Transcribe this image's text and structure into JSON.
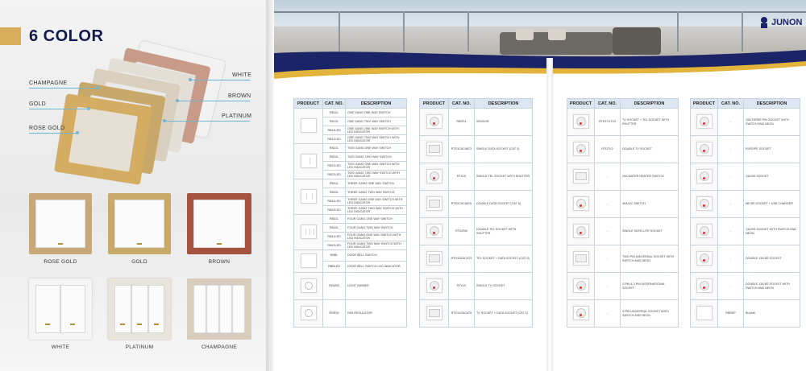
{
  "page1": {
    "title": "6 COLOR",
    "callouts_left": [
      "CHAMPAGNE",
      "GOLD",
      "ROSE GOLD"
    ],
    "callouts_right": [
      "WHITE",
      "BROWN",
      "PLATINUM"
    ],
    "swatch_labels": [
      "ROSE GOLD",
      "GOLD",
      "BROWN",
      "WHITE",
      "PLATINUM",
      "CHAMPAGNE"
    ],
    "colors": {
      "rose_gold": "#c9a877",
      "gold": "#c7a96a",
      "brown": "#a5523e",
      "white": "#f4f4f4",
      "platinum": "#e6e2da",
      "champagne": "#d8cdbc",
      "accent": "#d8ad5c",
      "navy": "#111a4a"
    }
  },
  "brand": {
    "logo_text": "JUNON"
  },
  "headers": [
    "PRODUCT",
    "CAT. NO.",
    "DESCRIPTION"
  ],
  "table1": [
    {
      "code": "RB11L",
      "desc": "ONE GANG ONE WAY SWITCH"
    },
    {
      "code": "RB12L",
      "desc": "ONE GANG TWO WAY SWITCH"
    },
    {
      "code": "RB11LED",
      "desc": "ONE GANG ONE WAY SWITCH WITH LED INDICATOR"
    },
    {
      "code": "RB12LED",
      "desc": "ONE GANG TWO WAY SWITCH WITH LED INDICATOR"
    },
    {
      "code": "RB21L",
      "desc": "TWO GANG ONE WAY SWITCH"
    },
    {
      "code": "RB22L",
      "desc": "TWO GANG TWO WAY SWITCH"
    },
    {
      "code": "RB21LED",
      "desc": "TWO GANG ONE WAY SWITCH WITH LED INDICATOR"
    },
    {
      "code": "RB22LED",
      "desc": "TWO GANG TWO WAY SWITCH WITH LED INDICATOR"
    },
    {
      "code": "RB31L",
      "desc": "THREE GANG ONE WAY SWITCH"
    },
    {
      "code": "RB32L",
      "desc": "THREE GANG TWO WAY SWITCH"
    },
    {
      "code": "RB31LED",
      "desc": "THREE GANG ONE WAY SWITCH WITH LED INDICATOR"
    },
    {
      "code": "RB32LED",
      "desc": "THREE GANG TWO WAY SWITCH WITH LED INDICATOR"
    },
    {
      "code": "RB41L",
      "desc": "FOUR GANG ONE WAY SWITCH"
    },
    {
      "code": "RB42L",
      "desc": "FOUR GANG TWO WAY SWITCH"
    },
    {
      "code": "RB41LED",
      "desc": "FOUR GANG ONE WAY SWITCH WITH LED INDICATOR"
    },
    {
      "code": "RB42LED",
      "desc": "FOUR GANG TWO WAY SWITCH WITH LED INDICATOR"
    },
    {
      "code": "RBBL",
      "desc": "DOOR BELL SWITCH"
    },
    {
      "code": "RBBLED",
      "desc": "DOOR BELL SWITCH LED INDICATOR"
    },
    {
      "code": "RDM30",
      "desc": "LIGHT DIMMER"
    },
    {
      "code": "RSR30",
      "desc": "FAN REGULATOR"
    }
  ],
  "table2": [
    {
      "code": "RBRS1",
      "desc": "SENSOR"
    },
    {
      "code": "RTD1C6C6AT3",
      "desc": "SINGLE DATA SOCKET (CAT 3)"
    },
    {
      "code": "RT01S",
      "desc": "SINGLE TEL SOCKET WITH SHUTTER"
    },
    {
      "code": "RTD2C6C6AT6",
      "desc": "DOUBLE DATA SOCKET (CAT 6)"
    },
    {
      "code": "RT02SW",
      "desc": "DOUBLE TEL SOCKET WITH SHUTTER"
    },
    {
      "code": "RTD1DC6CAT5",
      "desc": "TEL SOCKET + DATA SOCKET (CAT 5)"
    },
    {
      "code": "RTV1V",
      "desc": "SINGLE TV SOCKET"
    },
    {
      "code": "RTV1VC6CAT5",
      "desc": "TV SOCKET + DATA SOCKET (CAT 5)"
    }
  ],
  "table3": [
    {
      "code": "RTDTV1T1S",
      "desc": "TV SOCKET + TEL SOCKET WITH SHUTTER"
    },
    {
      "code": "RTDTV2",
      "desc": "DOUBLE TV SOCKET"
    },
    {
      "code": "-",
      "desc": "20A WATER HEATER SWITCH"
    },
    {
      "code": "-",
      "desc": "45A A/C SWITCH"
    },
    {
      "code": "-",
      "desc": "SINGLE SATELLITE SOCKET"
    },
    {
      "code": "-",
      "desc": "TWO PIN UNIVERSAL SOCKET WITH SWITCH AND NEON"
    },
    {
      "code": "-",
      "desc": "2 PIN & 3 PIN INTERNATIONAL SOCKET"
    },
    {
      "code": "-",
      "desc": "3 PIN UNIVERSAL SOCKET WITH SWITCH AND NEON"
    }
  ],
  "table4": [
    {
      "code": "-",
      "desc": "15A THREE PIN SOCKET WITH SWITCH AND NEON"
    },
    {
      "code": "-",
      "desc": "EUROPE SOCKET"
    },
    {
      "code": "-",
      "desc": "13A BS SOCKET"
    },
    {
      "code": "-",
      "desc": "MK BS SOCKET + USB CHARGER"
    },
    {
      "code": "-",
      "desc": "13A BS SOCKET WITH SWITCH AND NEON"
    },
    {
      "code": "-",
      "desc": "DOUBLE 13A BS SOCKET"
    },
    {
      "code": "-",
      "desc": "DOUBLE 13A BS SOCKET WITH SWITCH AND NEON"
    },
    {
      "code": "RBBKP",
      "desc": "BLANK"
    }
  ]
}
